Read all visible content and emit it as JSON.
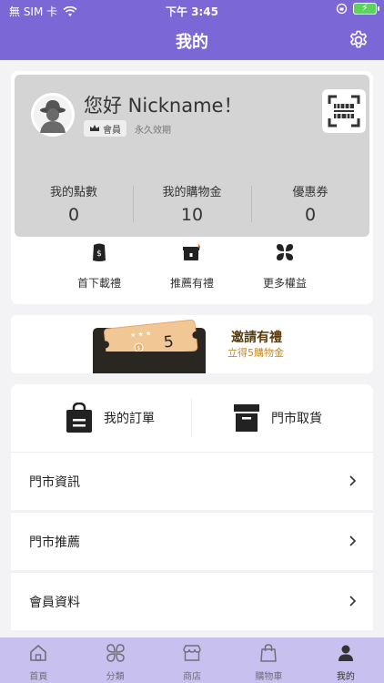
{
  "status_bar": {
    "carrier": "無 SIM 卡",
    "time": "下午 3:45"
  },
  "nav": {
    "title": "我的"
  },
  "profile": {
    "greeting": "您好 Nickname！",
    "member_badge": "會員",
    "validity": "永久效期"
  },
  "stats": [
    {
      "label": "我的點數",
      "value": "0"
    },
    {
      "label": "我的購物金",
      "value": "10"
    },
    {
      "label": "優惠券",
      "value": "0"
    }
  ],
  "perks": [
    {
      "label": "首下載禮",
      "icon": "gift-bag-icon"
    },
    {
      "label": "推薦有禮",
      "icon": "gift-box-icon"
    },
    {
      "label": "更多權益",
      "icon": "four-leaf-icon"
    }
  ],
  "banner": {
    "title": "邀請有禮",
    "subtitle": "立得5購物金",
    "ticket_value": "5"
  },
  "orders": {
    "my_orders": "我的訂單",
    "store_pickup": "門市取貨"
  },
  "menu": [
    {
      "label": "門市資訊"
    },
    {
      "label": "門市推薦"
    },
    {
      "label": "會員資料"
    }
  ],
  "tabs": [
    {
      "label": "首頁",
      "icon": "home-icon"
    },
    {
      "label": "分類",
      "icon": "category-icon"
    },
    {
      "label": "商店",
      "icon": "store-icon"
    },
    {
      "label": "購物車",
      "icon": "cart-icon"
    },
    {
      "label": "我的",
      "icon": "person-icon",
      "active": true
    }
  ],
  "colors": {
    "brand": "#7b68d6",
    "tabbar": "#c8c0ef",
    "accent_gold": "#c58a2a",
    "badge_red": "#e85b2c"
  }
}
